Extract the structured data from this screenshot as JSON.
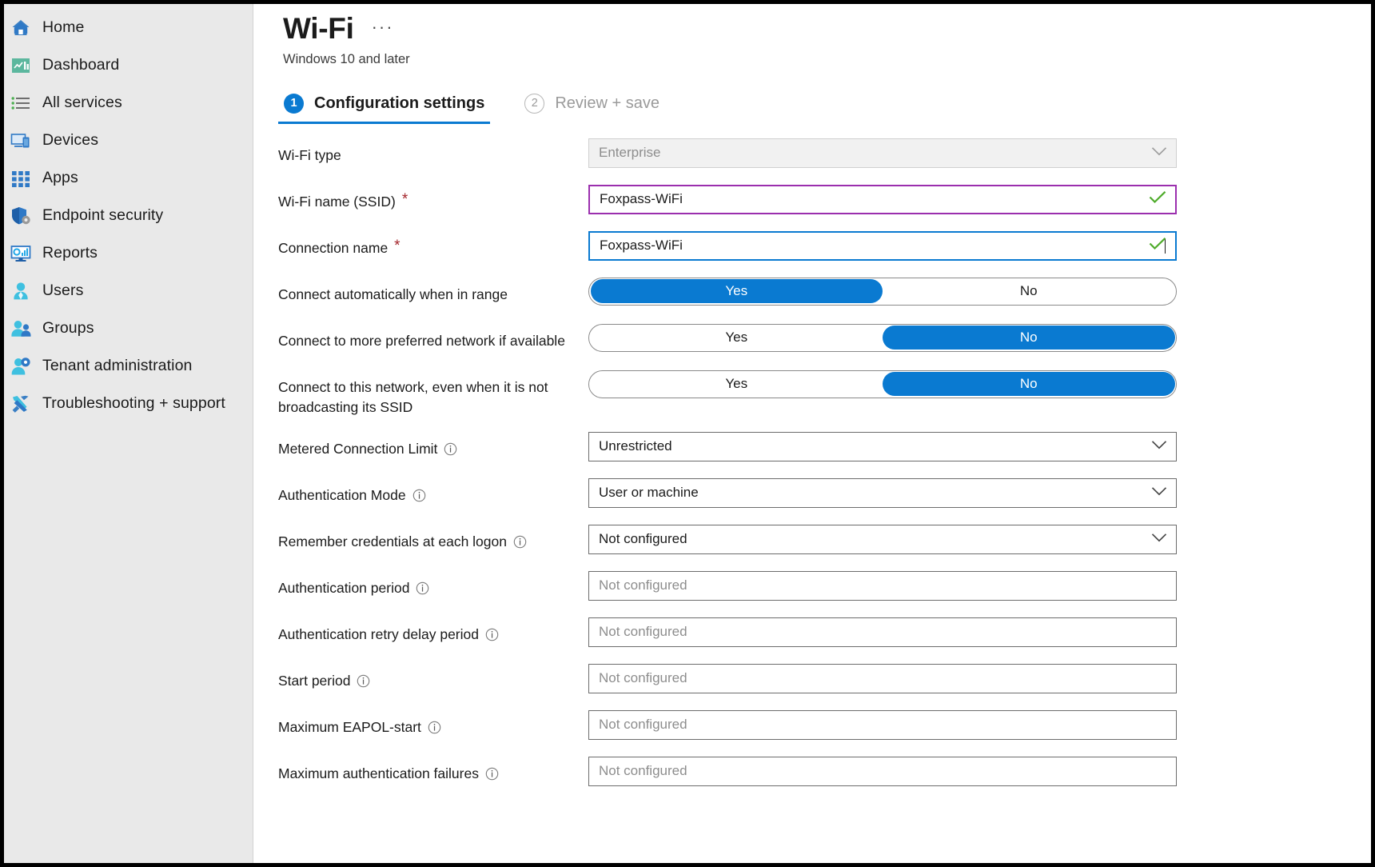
{
  "sidebar": {
    "items": [
      {
        "label": "Home",
        "icon": "home-icon"
      },
      {
        "label": "Dashboard",
        "icon": "dashboard-icon"
      },
      {
        "label": "All services",
        "icon": "all-services-icon"
      },
      {
        "label": "Devices",
        "icon": "devices-icon"
      },
      {
        "label": "Apps",
        "icon": "apps-icon"
      },
      {
        "label": "Endpoint security",
        "icon": "shield-gear-icon"
      },
      {
        "label": "Reports",
        "icon": "reports-monitor-icon"
      },
      {
        "label": "Users",
        "icon": "user-icon"
      },
      {
        "label": "Groups",
        "icon": "groups-icon"
      },
      {
        "label": "Tenant administration",
        "icon": "user-gear-icon"
      },
      {
        "label": "Troubleshooting + support",
        "icon": "wrench-screwdriver-icon"
      }
    ]
  },
  "header": {
    "title": "Wi-Fi",
    "more_label": "···",
    "subtitle": "Windows 10 and later"
  },
  "tabs": [
    {
      "num": "1",
      "label": "Configuration settings",
      "active": true
    },
    {
      "num": "2",
      "label": "Review + save",
      "active": false
    }
  ],
  "form": {
    "rows": [
      {
        "id": "wifi-type",
        "label": "Wi-Fi type",
        "required": false,
        "info": false,
        "type": "dropdown",
        "value": "Enterprise",
        "disabled": true,
        "placeholder_style": true
      },
      {
        "id": "wifi-name-ssid",
        "label": "Wi-Fi name (SSID)",
        "required": true,
        "info": false,
        "type": "text",
        "value": "Foxpass-WiFi",
        "border": "purple",
        "valid": true
      },
      {
        "id": "connection-name",
        "label": "Connection name",
        "required": true,
        "info": false,
        "type": "text",
        "value": "Foxpass-WiFi",
        "border": "blue",
        "focused": true,
        "valid": true
      },
      {
        "id": "connect-automatically-when-in-range",
        "label": "Connect automatically when in range",
        "required": false,
        "info": false,
        "type": "toggle",
        "options": [
          "Yes",
          "No"
        ],
        "selected": "Yes"
      },
      {
        "id": "connect-to-more-preferred-network-if-available",
        "label": "Connect to more preferred network if available",
        "required": false,
        "info": false,
        "type": "toggle",
        "options": [
          "Yes",
          "No"
        ],
        "selected": "No"
      },
      {
        "id": "connect-when-not-broadcasting-ssid",
        "label": "Connect to this network, even when it is not broadcasting its SSID",
        "required": false,
        "info": false,
        "type": "toggle",
        "options": [
          "Yes",
          "No"
        ],
        "selected": "No"
      },
      {
        "id": "metered-connection-limit",
        "label": "Metered Connection Limit",
        "required": false,
        "info": true,
        "type": "dropdown",
        "value": "Unrestricted",
        "placeholder_style": false
      },
      {
        "id": "authentication-mode",
        "label": "Authentication Mode",
        "required": false,
        "info": true,
        "type": "dropdown",
        "value": "User or machine",
        "placeholder_style": false
      },
      {
        "id": "remember-credentials-at-each-logon",
        "label": "Remember credentials at each logon",
        "required": false,
        "info": true,
        "type": "dropdown",
        "value": "Not configured",
        "placeholder_style": false
      },
      {
        "id": "authentication-period",
        "label": "Authentication period",
        "required": false,
        "info": true,
        "type": "text",
        "value": "Not configured",
        "placeholder_style": true
      },
      {
        "id": "authentication-retry-delay-period",
        "label": "Authentication retry delay period",
        "required": false,
        "info": true,
        "type": "text",
        "value": "Not configured",
        "placeholder_style": true
      },
      {
        "id": "start-period",
        "label": "Start period",
        "required": false,
        "info": true,
        "type": "text",
        "value": "Not configured",
        "placeholder_style": true
      },
      {
        "id": "maximum-eapol-start",
        "label": "Maximum EAPOL-start",
        "required": false,
        "info": true,
        "type": "text",
        "value": "Not configured",
        "placeholder_style": true
      },
      {
        "id": "maximum-authentication-failures",
        "label": "Maximum authentication failures",
        "required": false,
        "info": true,
        "type": "text",
        "value": "Not configured",
        "placeholder_style": true
      }
    ]
  },
  "colors": {
    "accent": "#0a7ad1",
    "required_asterisk": "#a4262c",
    "valid_check": "#4eab2a",
    "focus_border": "#0a7ad1",
    "modified_border": "#9b2fae",
    "sidebar_bg": "#e9e9e9"
  }
}
